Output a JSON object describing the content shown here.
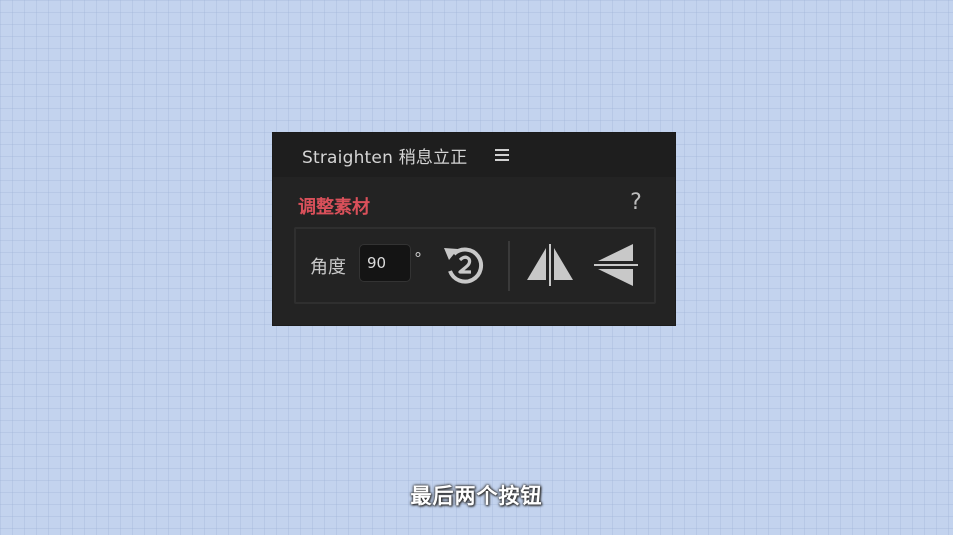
{
  "panel": {
    "title": "Straighten 稍息立正",
    "menu_icon": "hamburger-menu-icon",
    "section_title": "调整素材",
    "help_label": "?",
    "angle_label": "角度",
    "angle_value": "90",
    "degree_symbol": "°",
    "rotate_icon": "rotate-counterclockwise-icon",
    "flip_horizontal_icon": "flip-horizontal-icon",
    "flip_vertical_icon": "flip-vertical-icon"
  },
  "subtitle": "最后两个按钮",
  "colors": {
    "background": "#c3d3ee",
    "panel_bg": "#232323",
    "accent": "#d9505a",
    "icon": "#c8c8c8"
  }
}
